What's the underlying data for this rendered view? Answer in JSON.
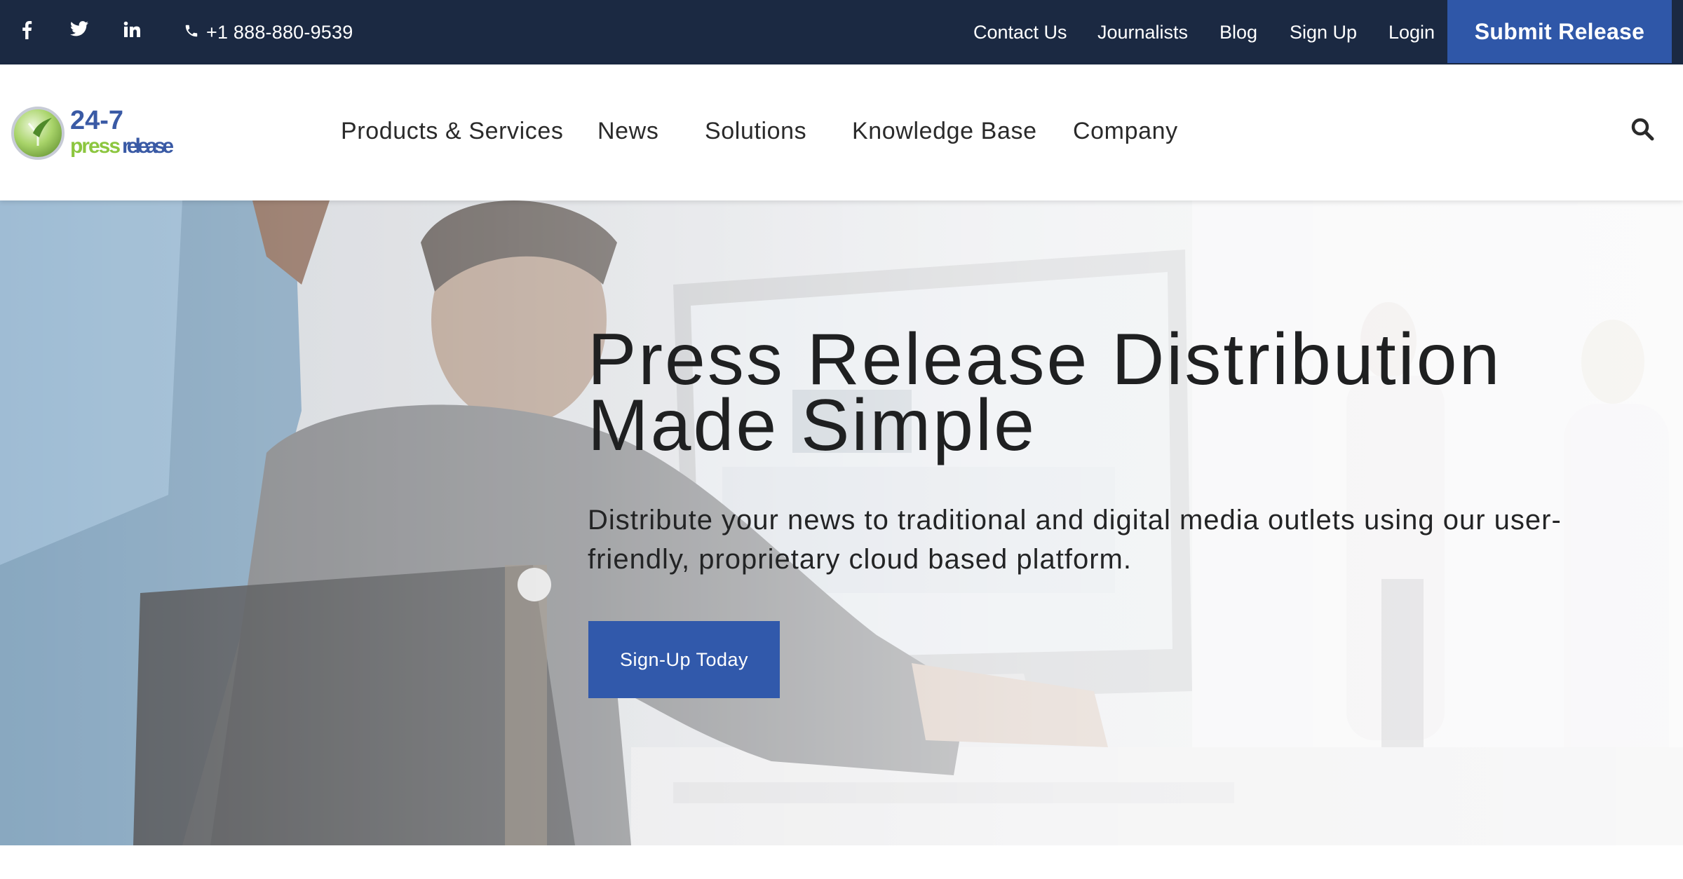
{
  "topbar": {
    "social": {
      "facebook_icon": "facebook-icon",
      "twitter_icon": "twitter-icon",
      "linkedin_icon": "linkedin-icon"
    },
    "phone_icon": "phone-icon",
    "phone": "+1 888-880-9539",
    "links": {
      "contact": "Contact Us",
      "journalists": "Journalists",
      "blog": "Blog",
      "signup": "Sign Up",
      "login": "Login"
    },
    "submit_label": "Submit Release"
  },
  "nav": {
    "logo": {
      "top": "24-7",
      "bottom_left": "press",
      "bottom_right": "release"
    },
    "items": {
      "products": "Products & Services",
      "news": "News",
      "solutions": "Solutions",
      "knowledge": "Knowledge Base",
      "company": "Company"
    },
    "search_icon": "search-icon"
  },
  "hero": {
    "title": "Press Release Distribution Made Simple",
    "subtitle": "Distribute your news to traditional and digital media outlets using our user-friendly, proprietary cloud based platform.",
    "cta_label": "Sign-Up Today"
  },
  "colors": {
    "topbar_bg": "#1b2942",
    "accent_blue": "#2f57a8",
    "logo_green": "#8cc63f",
    "logo_blue": "#3a5aa5"
  }
}
